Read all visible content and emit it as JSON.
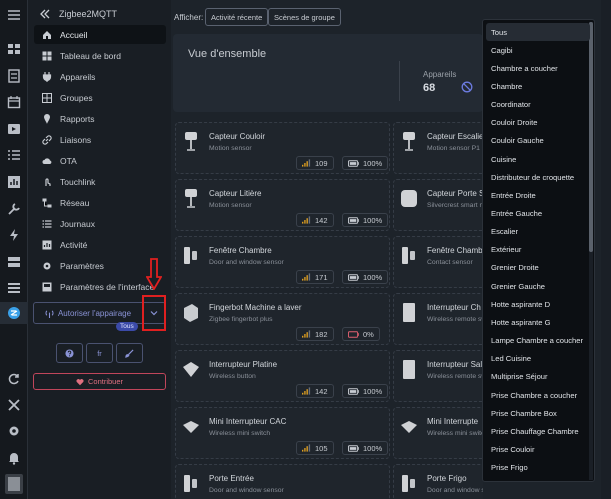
{
  "app": {
    "title": "Zigbee2MQTT"
  },
  "sidebar": {
    "items": [
      {
        "label": "Accueil",
        "icon": "home-icon"
      },
      {
        "label": "Tableau de bord",
        "icon": "dashboard-icon"
      },
      {
        "label": "Appareils",
        "icon": "plug-icon"
      },
      {
        "label": "Groupes",
        "icon": "groups-icon"
      },
      {
        "label": "Rapports",
        "icon": "pin-icon"
      },
      {
        "label": "Liaisons",
        "icon": "link-icon"
      },
      {
        "label": "OTA",
        "icon": "cloud-icon"
      },
      {
        "label": "Touchlink",
        "icon": "touch-icon"
      },
      {
        "label": "Réseau",
        "icon": "network-icon"
      },
      {
        "label": "Journaux",
        "icon": "list-icon"
      },
      {
        "label": "Activité",
        "icon": "activity-icon"
      },
      {
        "label": "Paramètres",
        "icon": "gear-icon"
      },
      {
        "label": "Paramètres de l'interface",
        "icon": "interface-icon"
      }
    ],
    "pair_button": "Autoriser l'appairage",
    "pair_badge": "Tous",
    "lang": "fr",
    "contribute": "Contribuer"
  },
  "topbar": {
    "show_label": "Afficher:",
    "recent_activity": "Activité récente",
    "group_scenes": "Scènes de groupe"
  },
  "overview": {
    "title": "Vue d'ensemble",
    "devices_label": "Appareils",
    "devices_count": "68"
  },
  "devices": [
    {
      "name": "Capteur Couloir",
      "model": "Motion sensor",
      "lqi": "109",
      "battery": "100%",
      "low": false
    },
    {
      "name": "Capteur Escalier",
      "model": "Motion sensor P1",
      "lqi": "",
      "battery": "",
      "low": false
    },
    {
      "name": "Capteur Litière",
      "model": "Motion sensor",
      "lqi": "142",
      "battery": "100%",
      "low": false
    },
    {
      "name": "Capteur Porte S",
      "model": "Silvercrest smart m",
      "lqi": "",
      "battery": "",
      "low": false
    },
    {
      "name": "Fenêtre Chambre",
      "model": "Door and window sensor",
      "lqi": "171",
      "battery": "100%",
      "low": false
    },
    {
      "name": "Fenêtre Chamb",
      "model": "Contact sensor",
      "lqi": "",
      "battery": "",
      "low": false
    },
    {
      "name": "Fingerbot Machine a laver",
      "model": "Zigbee fingerbot plus",
      "lqi": "182",
      "battery": "0%",
      "low": true
    },
    {
      "name": "Interrupteur Ch",
      "model": "Wireless remote sw",
      "lqi": "",
      "battery": "",
      "low": false
    },
    {
      "name": "Interrupteur Platine",
      "model": "Wireless button",
      "lqi": "142",
      "battery": "100%",
      "low": false
    },
    {
      "name": "Interrupteur Sal",
      "model": "Wireless remote sw",
      "lqi": "",
      "battery": "",
      "low": false
    },
    {
      "name": "Mini Interrupteur CAC",
      "model": "Wireless mini switch",
      "lqi": "105",
      "battery": "100%",
      "low": false
    },
    {
      "name": "Mini Interrupte",
      "model": "Wireless mini switc",
      "lqi": "",
      "battery": "",
      "low": false
    },
    {
      "name": "Porte Entrée",
      "model": "Door and window sensor",
      "lqi": "",
      "battery": "",
      "low": false
    },
    {
      "name": "Porte Frigo",
      "model": "Door and window se",
      "lqi": "",
      "battery": "",
      "low": false
    }
  ],
  "dropdown": {
    "options": [
      "Tous",
      "Cagibi",
      "Chambre a coucher",
      "Chambre",
      "Coordinator",
      "Couloir Droite",
      "Couloir Gauche",
      "Cuisine",
      "Distributeur de croquette",
      "Entrée Droite",
      "Entrée Gauche",
      "Escalier",
      "Extérieur",
      "Grenier Droite",
      "Grenier Gauche",
      "Hotte aspirante D",
      "Hotte aspirante G",
      "Lampe Chambre a coucher",
      "Led Cuisine",
      "Multiprise Séjour",
      "Prise Chambre a coucher",
      "Prise Chambre Box",
      "Prise Chauffage Chambre",
      "Prise Couloir",
      "Prise Frigo"
    ],
    "selected": "Tous"
  },
  "colors": {
    "accent": "#8a93d6",
    "danger": "#e02020",
    "bg": "#1d232a"
  }
}
